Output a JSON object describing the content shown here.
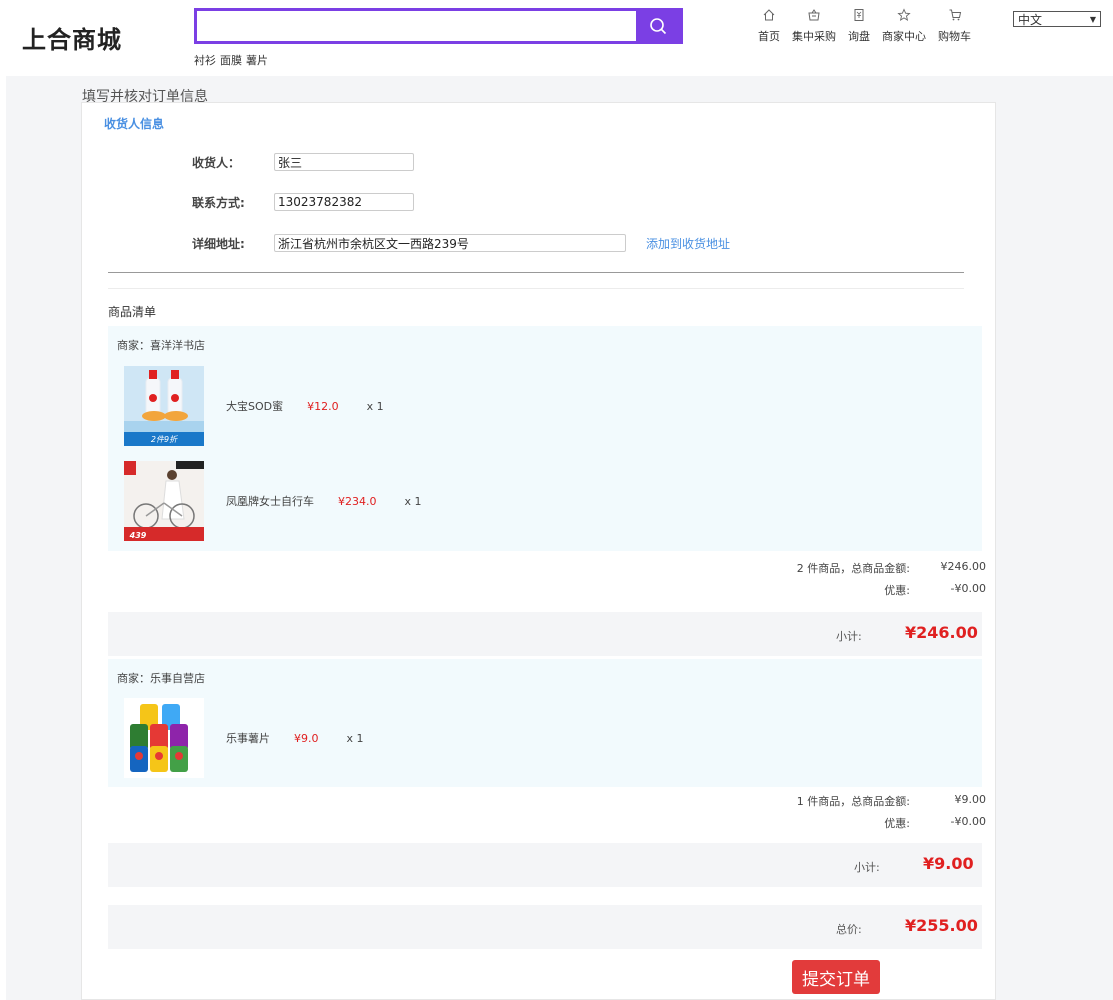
{
  "header": {
    "logo": "上合商城",
    "search": {
      "value": "",
      "placeholder": ""
    },
    "hot_words": [
      "衬衫",
      "面膜",
      "薯片"
    ],
    "nav": [
      {
        "label": "首页",
        "icon": "home-icon"
      },
      {
        "label": "集中采购",
        "icon": "basket-icon"
      },
      {
        "label": "询盘",
        "icon": "inquiry-icon"
      },
      {
        "label": "商家中心",
        "icon": "star-icon"
      },
      {
        "label": "购物车",
        "icon": "cart-icon"
      }
    ],
    "language": "中文"
  },
  "page": {
    "heading": "填写并核对订单信息"
  },
  "receiver": {
    "section_title": "收货人信息",
    "name_label": "收货人：",
    "name_value": "张三",
    "phone_label": "联系方式:",
    "phone_value": "13023782382",
    "address_label": "详细地址:",
    "address_value": "浙江省杭州市余杭区文一西路239号",
    "add_address_link": "添加到收货地址"
  },
  "goods": {
    "title": "商品清单",
    "shops": [
      {
        "name": "商家：喜洋洋书店",
        "products": [
          {
            "name": "大宝SOD蜜",
            "price": "¥12.0",
            "qty": "x 1",
            "image_caption": "2件9折"
          },
          {
            "name": "凤凰牌女士自行车",
            "price": "¥234.0",
            "qty": "x 1",
            "image_caption": "439"
          }
        ],
        "count_label": "2 件商品，总商品金额:",
        "total": "¥246.00",
        "discount_label": "优惠:",
        "discount": "-¥0.00",
        "subtotal_label": "小计:",
        "subtotal": "¥246.00"
      },
      {
        "name": "商家：乐事自营店",
        "products": [
          {
            "name": "乐事薯片",
            "price": "¥9.0",
            "qty": "x 1"
          }
        ],
        "count_label": "1 件商品，总商品金额:",
        "total": "¥9.00",
        "discount_label": "优惠:",
        "discount": "-¥0.00",
        "subtotal_label": "小计:",
        "subtotal": "¥9.00"
      }
    ]
  },
  "order": {
    "grand_total_label": "总价:",
    "grand_total": "¥255.00",
    "submit_label": "提交订单"
  },
  "colors": {
    "accent": "#7b3fe4",
    "price_red": "#e02020",
    "link_blue": "#4a90e2",
    "submit_red": "#e23b3b"
  }
}
